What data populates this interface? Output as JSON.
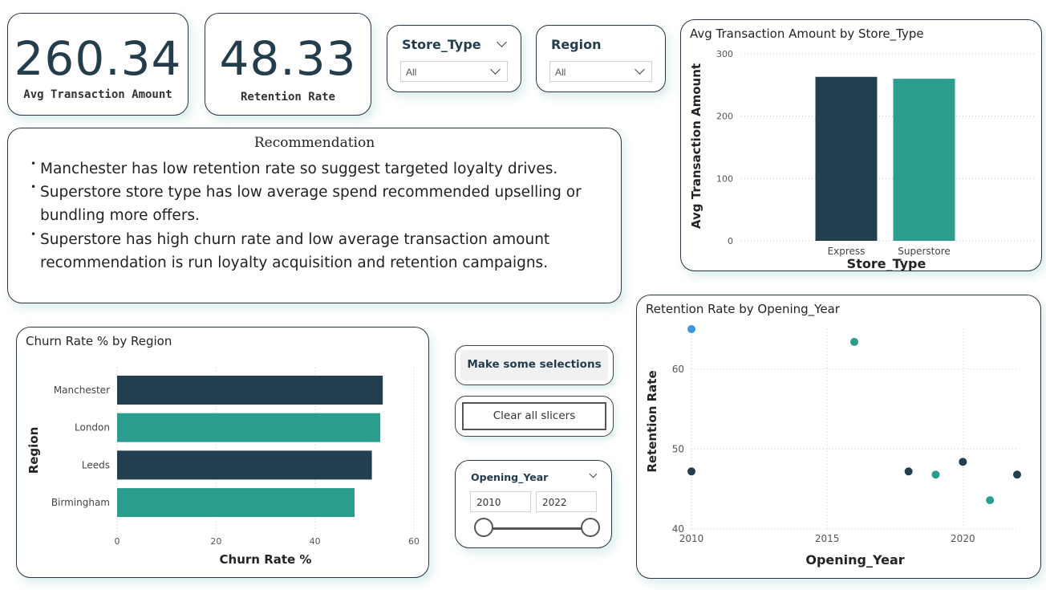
{
  "kpis": [
    {
      "value": "260.34",
      "label": "Avg Transaction Amount"
    },
    {
      "value": "48.33",
      "label": "Retention Rate"
    }
  ],
  "slicers": {
    "store_type": {
      "title": "Store_Type",
      "value": "All"
    },
    "region": {
      "title": "Region",
      "value": "All"
    },
    "opening_year": {
      "title": "Opening_Year",
      "min": "2010",
      "max": "2022"
    }
  },
  "recommendation": {
    "title": "Recommendation",
    "items": [
      "Manchester has low retention rate so suggest targeted loyalty drives.",
      "Superstore store type has low average spend recommended upselling or bundling more offers.",
      "Superstore has high churn rate and low average transaction amount recommendation is run loyalty acquisition and retention campaigns."
    ]
  },
  "buttons": {
    "make_selections": "Make some selections",
    "clear_slicers": "Clear all slicers"
  },
  "colors": {
    "dark": "#233f4f",
    "teal": "#2a9d8f",
    "blue": "#3a97e0"
  },
  "chart_data": [
    {
      "type": "bar",
      "title": "Avg Transaction Amount by Store_Type",
      "xlabel": "Store_Type",
      "ylabel": "Avg Transaction Amount",
      "categories": [
        "Express",
        "Superstore"
      ],
      "values": [
        263,
        260
      ],
      "ylim": [
        0,
        300
      ],
      "yticks": [
        0,
        100,
        200,
        300
      ],
      "grid": true
    },
    {
      "type": "bar",
      "orientation": "horizontal",
      "title": "Churn Rate % by Region",
      "xlabel": "Churn Rate %",
      "ylabel": "Region",
      "categories": [
        "Manchester",
        "London",
        "Leeds",
        "Birmingham"
      ],
      "values": [
        53.7,
        53.2,
        51.5,
        48.0
      ],
      "xlim": [
        0,
        60
      ],
      "xticks": [
        0,
        20,
        40,
        60
      ],
      "grid": true
    },
    {
      "type": "scatter",
      "title": "Retention Rate by Opening_Year",
      "xlabel": "Opening_Year",
      "ylabel": "Retention Rate",
      "xlim": [
        2010,
        2022
      ],
      "ylim": [
        40,
        65
      ],
      "xticks": [
        2010,
        2015,
        2020
      ],
      "yticks": [
        40,
        50,
        60
      ],
      "grid": true,
      "points": [
        {
          "x": 2010,
          "y": 65,
          "color": "blue"
        },
        {
          "x": 2010,
          "y": 47.2,
          "color": "dark"
        },
        {
          "x": 2016,
          "y": 63.4,
          "color": "teal"
        },
        {
          "x": 2018,
          "y": 47.2,
          "color": "dark"
        },
        {
          "x": 2019,
          "y": 46.8,
          "color": "teal"
        },
        {
          "x": 2020,
          "y": 48.4,
          "color": "dark"
        },
        {
          "x": 2021,
          "y": 43.6,
          "color": "teal"
        },
        {
          "x": 2022,
          "y": 46.8,
          "color": "dark"
        }
      ]
    }
  ]
}
